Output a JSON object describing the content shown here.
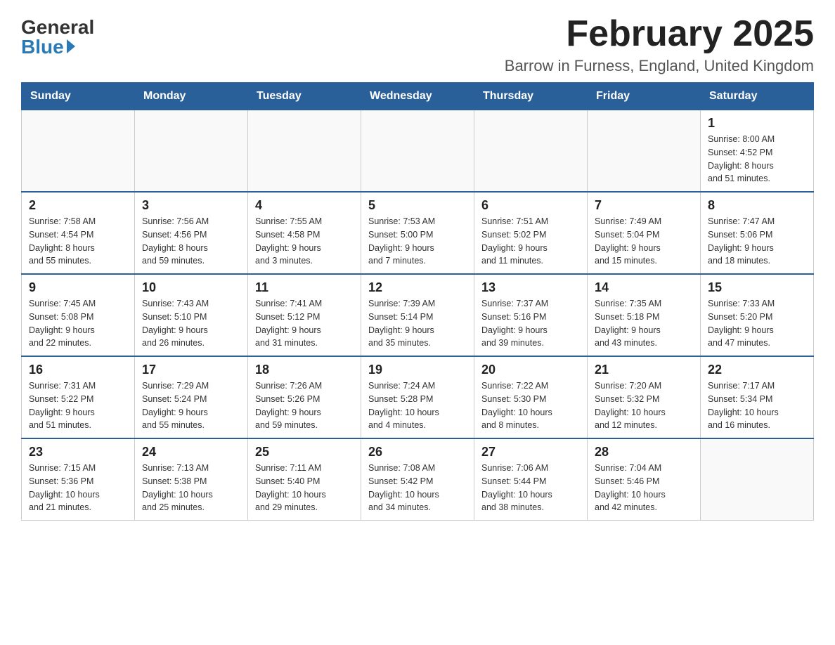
{
  "logo": {
    "general": "General",
    "blue": "Blue"
  },
  "header": {
    "title": "February 2025",
    "location": "Barrow in Furness, England, United Kingdom"
  },
  "weekdays": [
    "Sunday",
    "Monday",
    "Tuesday",
    "Wednesday",
    "Thursday",
    "Friday",
    "Saturday"
  ],
  "weeks": [
    [
      {
        "day": "",
        "info": ""
      },
      {
        "day": "",
        "info": ""
      },
      {
        "day": "",
        "info": ""
      },
      {
        "day": "",
        "info": ""
      },
      {
        "day": "",
        "info": ""
      },
      {
        "day": "",
        "info": ""
      },
      {
        "day": "1",
        "info": "Sunrise: 8:00 AM\nSunset: 4:52 PM\nDaylight: 8 hours\nand 51 minutes."
      }
    ],
    [
      {
        "day": "2",
        "info": "Sunrise: 7:58 AM\nSunset: 4:54 PM\nDaylight: 8 hours\nand 55 minutes."
      },
      {
        "day": "3",
        "info": "Sunrise: 7:56 AM\nSunset: 4:56 PM\nDaylight: 8 hours\nand 59 minutes."
      },
      {
        "day": "4",
        "info": "Sunrise: 7:55 AM\nSunset: 4:58 PM\nDaylight: 9 hours\nand 3 minutes."
      },
      {
        "day": "5",
        "info": "Sunrise: 7:53 AM\nSunset: 5:00 PM\nDaylight: 9 hours\nand 7 minutes."
      },
      {
        "day": "6",
        "info": "Sunrise: 7:51 AM\nSunset: 5:02 PM\nDaylight: 9 hours\nand 11 minutes."
      },
      {
        "day": "7",
        "info": "Sunrise: 7:49 AM\nSunset: 5:04 PM\nDaylight: 9 hours\nand 15 minutes."
      },
      {
        "day": "8",
        "info": "Sunrise: 7:47 AM\nSunset: 5:06 PM\nDaylight: 9 hours\nand 18 minutes."
      }
    ],
    [
      {
        "day": "9",
        "info": "Sunrise: 7:45 AM\nSunset: 5:08 PM\nDaylight: 9 hours\nand 22 minutes."
      },
      {
        "day": "10",
        "info": "Sunrise: 7:43 AM\nSunset: 5:10 PM\nDaylight: 9 hours\nand 26 minutes."
      },
      {
        "day": "11",
        "info": "Sunrise: 7:41 AM\nSunset: 5:12 PM\nDaylight: 9 hours\nand 31 minutes."
      },
      {
        "day": "12",
        "info": "Sunrise: 7:39 AM\nSunset: 5:14 PM\nDaylight: 9 hours\nand 35 minutes."
      },
      {
        "day": "13",
        "info": "Sunrise: 7:37 AM\nSunset: 5:16 PM\nDaylight: 9 hours\nand 39 minutes."
      },
      {
        "day": "14",
        "info": "Sunrise: 7:35 AM\nSunset: 5:18 PM\nDaylight: 9 hours\nand 43 minutes."
      },
      {
        "day": "15",
        "info": "Sunrise: 7:33 AM\nSunset: 5:20 PM\nDaylight: 9 hours\nand 47 minutes."
      }
    ],
    [
      {
        "day": "16",
        "info": "Sunrise: 7:31 AM\nSunset: 5:22 PM\nDaylight: 9 hours\nand 51 minutes."
      },
      {
        "day": "17",
        "info": "Sunrise: 7:29 AM\nSunset: 5:24 PM\nDaylight: 9 hours\nand 55 minutes."
      },
      {
        "day": "18",
        "info": "Sunrise: 7:26 AM\nSunset: 5:26 PM\nDaylight: 9 hours\nand 59 minutes."
      },
      {
        "day": "19",
        "info": "Sunrise: 7:24 AM\nSunset: 5:28 PM\nDaylight: 10 hours\nand 4 minutes."
      },
      {
        "day": "20",
        "info": "Sunrise: 7:22 AM\nSunset: 5:30 PM\nDaylight: 10 hours\nand 8 minutes."
      },
      {
        "day": "21",
        "info": "Sunrise: 7:20 AM\nSunset: 5:32 PM\nDaylight: 10 hours\nand 12 minutes."
      },
      {
        "day": "22",
        "info": "Sunrise: 7:17 AM\nSunset: 5:34 PM\nDaylight: 10 hours\nand 16 minutes."
      }
    ],
    [
      {
        "day": "23",
        "info": "Sunrise: 7:15 AM\nSunset: 5:36 PM\nDaylight: 10 hours\nand 21 minutes."
      },
      {
        "day": "24",
        "info": "Sunrise: 7:13 AM\nSunset: 5:38 PM\nDaylight: 10 hours\nand 25 minutes."
      },
      {
        "day": "25",
        "info": "Sunrise: 7:11 AM\nSunset: 5:40 PM\nDaylight: 10 hours\nand 29 minutes."
      },
      {
        "day": "26",
        "info": "Sunrise: 7:08 AM\nSunset: 5:42 PM\nDaylight: 10 hours\nand 34 minutes."
      },
      {
        "day": "27",
        "info": "Sunrise: 7:06 AM\nSunset: 5:44 PM\nDaylight: 10 hours\nand 38 minutes."
      },
      {
        "day": "28",
        "info": "Sunrise: 7:04 AM\nSunset: 5:46 PM\nDaylight: 10 hours\nand 42 minutes."
      },
      {
        "day": "",
        "info": ""
      }
    ]
  ]
}
